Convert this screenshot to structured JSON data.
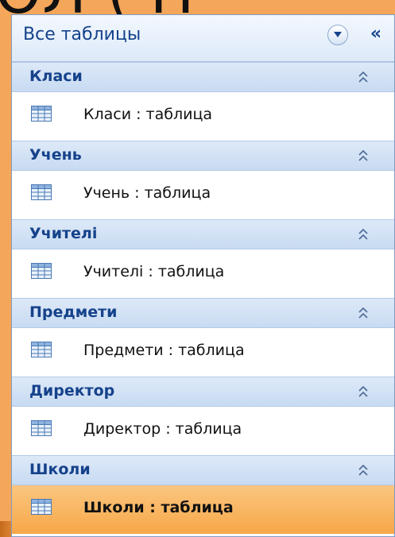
{
  "background_title": "ОЛ (  Н",
  "pane": {
    "title": "Все таблицы",
    "collapse_glyph": "«",
    "groups": [
      {
        "title": "Класи",
        "item": "Класи : таблица",
        "selected": false
      },
      {
        "title": "Учень",
        "item": "Учень : таблица",
        "selected": false
      },
      {
        "title": "Учителі",
        "item": "Учителі : таблица",
        "selected": false
      },
      {
        "title": "Предмети",
        "item": "Предмети : таблица",
        "selected": false
      },
      {
        "title": "Директор",
        "item": "Директор : таблица",
        "selected": false
      },
      {
        "title": "Школи",
        "item": "Школи : таблица",
        "selected": true
      }
    ]
  },
  "colors": {
    "slide_background": "#f4a65a",
    "header_text": "#15428b",
    "selected_item": "#f7a748"
  }
}
